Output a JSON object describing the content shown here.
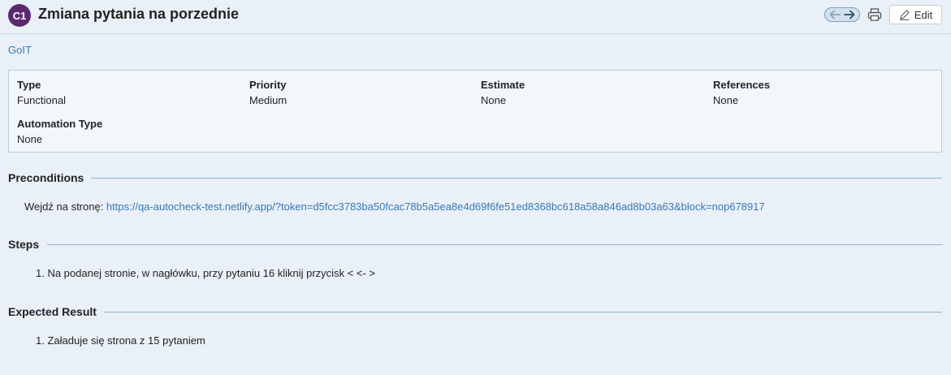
{
  "header": {
    "badge": "C1",
    "title": "Zmiana pytania na porzednie",
    "edit_label": "Edit"
  },
  "project": {
    "name": "GoIT"
  },
  "properties": {
    "type_label": "Type",
    "type_value": "Functional",
    "priority_label": "Priority",
    "priority_value": "Medium",
    "estimate_label": "Estimate",
    "estimate_value": "None",
    "references_label": "References",
    "references_value": "None",
    "automation_label": "Automation Type",
    "automation_value": "None"
  },
  "preconditions": {
    "title": "Preconditions",
    "prefix": "Wejdź na stronę: ",
    "url": "https://qa-autocheck-test.netlify.app/?token=d5fcc3783ba50fcac78b5a5ea8e4d69f6fe51ed8368bc618a58a846ad8b03a63&block=nop678917"
  },
  "steps": {
    "title": "Steps",
    "items": [
      "1. Na podanej stronie, w nagłówku, przy pytaniu 16 kliknij przycisk < <- >"
    ]
  },
  "expected": {
    "title": "Expected Result",
    "items": [
      "1. Załaduje się strona z 15 pytaniem"
    ]
  },
  "icons": {
    "prev": "arrow-left-icon",
    "next": "arrow-right-icon",
    "print": "printer-icon",
    "edit": "pencil-icon"
  },
  "colors": {
    "badge": "#5b2a6e",
    "link": "#3a78b4",
    "background": "#e9f0f7"
  }
}
